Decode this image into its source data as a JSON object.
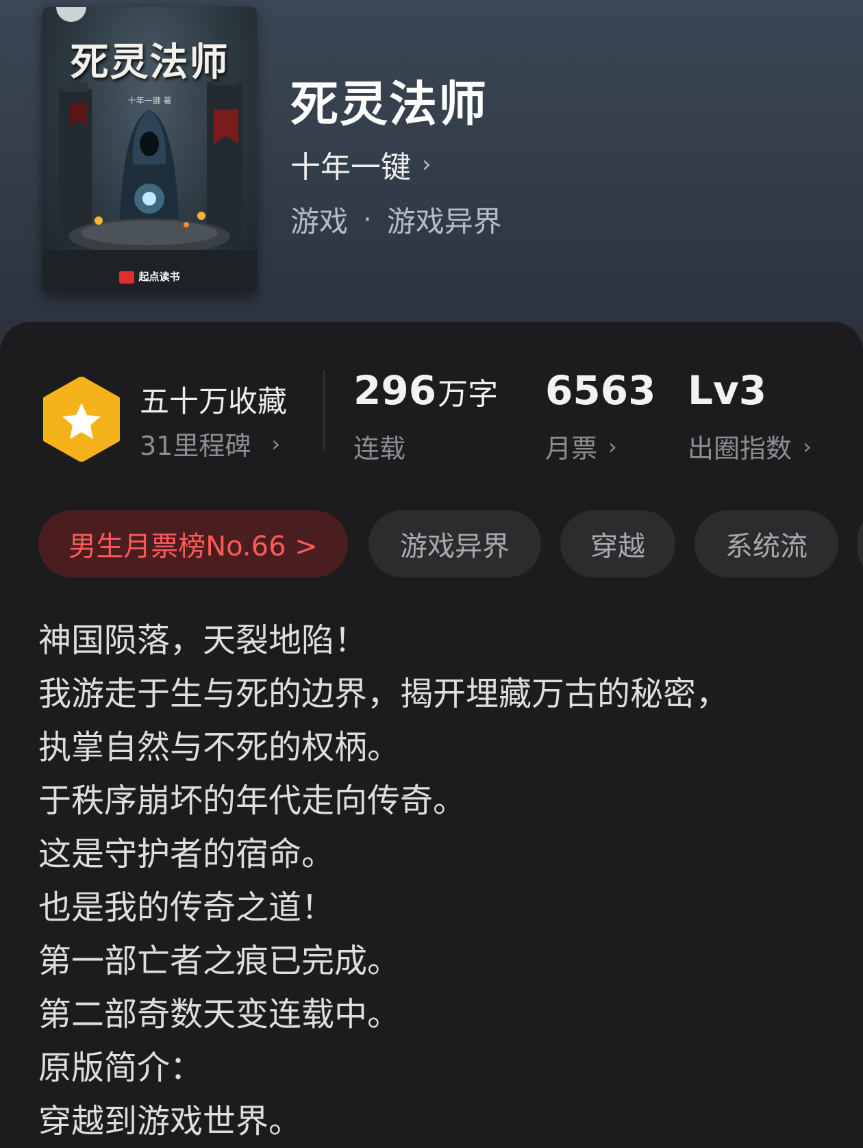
{
  "book": {
    "title": "死灵法师",
    "author": "十年一键",
    "genre_main": "游戏",
    "genre_sub": "游戏异界",
    "separator": "·"
  },
  "cover": {
    "title": "死灵法师",
    "author_line": "十年一键 著",
    "publisher": "起点读书"
  },
  "stats": {
    "favorites": {
      "title": "五十万收藏",
      "subtitle": "31里程碑"
    },
    "words": {
      "value": "296",
      "unit": "万字",
      "label": "连载"
    },
    "monthly_tickets": {
      "value": "6563",
      "label": "月票"
    },
    "influence": {
      "value": "Lv3",
      "label": "出圈指数"
    }
  },
  "tags": [
    {
      "label": "男生月票榜No.66 >"
    },
    {
      "label": "游戏异界"
    },
    {
      "label": "穿越"
    },
    {
      "label": "系统流"
    }
  ],
  "description": [
    "神国陨落，天裂地陷！",
    "我游走于生与死的边界，揭开埋藏万古的秘密，",
    "执掌自然与不死的权柄。",
    "于秩序崩坏的年代走向传奇。",
    "这是守护者的宿命。",
    "也是我的传奇之道！",
    "第一部亡者之痕已完成。",
    "第二部奇数天变连载中。",
    "原版简介：",
    "穿越到游戏世界。"
  ],
  "icons": {
    "chevron": "›",
    "badge": "star-hexagon-icon"
  },
  "colors": {
    "accent_rank": "#ff5a5a",
    "badge_fill": "#f6b21a",
    "background": "#1c1c1e"
  }
}
